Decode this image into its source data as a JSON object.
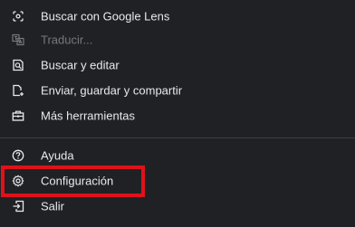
{
  "menu": {
    "items": [
      {
        "label": "Buscar con Google Lens",
        "icon": "google-lens-icon",
        "disabled": false
      },
      {
        "label": "Traducir...",
        "icon": "translate-icon",
        "disabled": true
      },
      {
        "label": "Buscar y editar",
        "icon": "search-edit-icon",
        "disabled": false
      },
      {
        "label": "Enviar, guardar y compartir",
        "icon": "share-save-icon",
        "disabled": false
      },
      {
        "label": "Más herramientas",
        "icon": "toolbox-icon",
        "disabled": false
      },
      {
        "label": "Ayuda",
        "icon": "help-icon",
        "disabled": false
      },
      {
        "label": "Configuración",
        "icon": "gear-icon",
        "disabled": false,
        "highlighted": true
      },
      {
        "label": "Salir",
        "icon": "exit-icon",
        "disabled": false
      }
    ]
  },
  "colors": {
    "background": "#202124",
    "text": "#e8eaed",
    "disabled_text": "#75787c",
    "divider": "#3c4043",
    "highlight_border": "#e0111a"
  }
}
